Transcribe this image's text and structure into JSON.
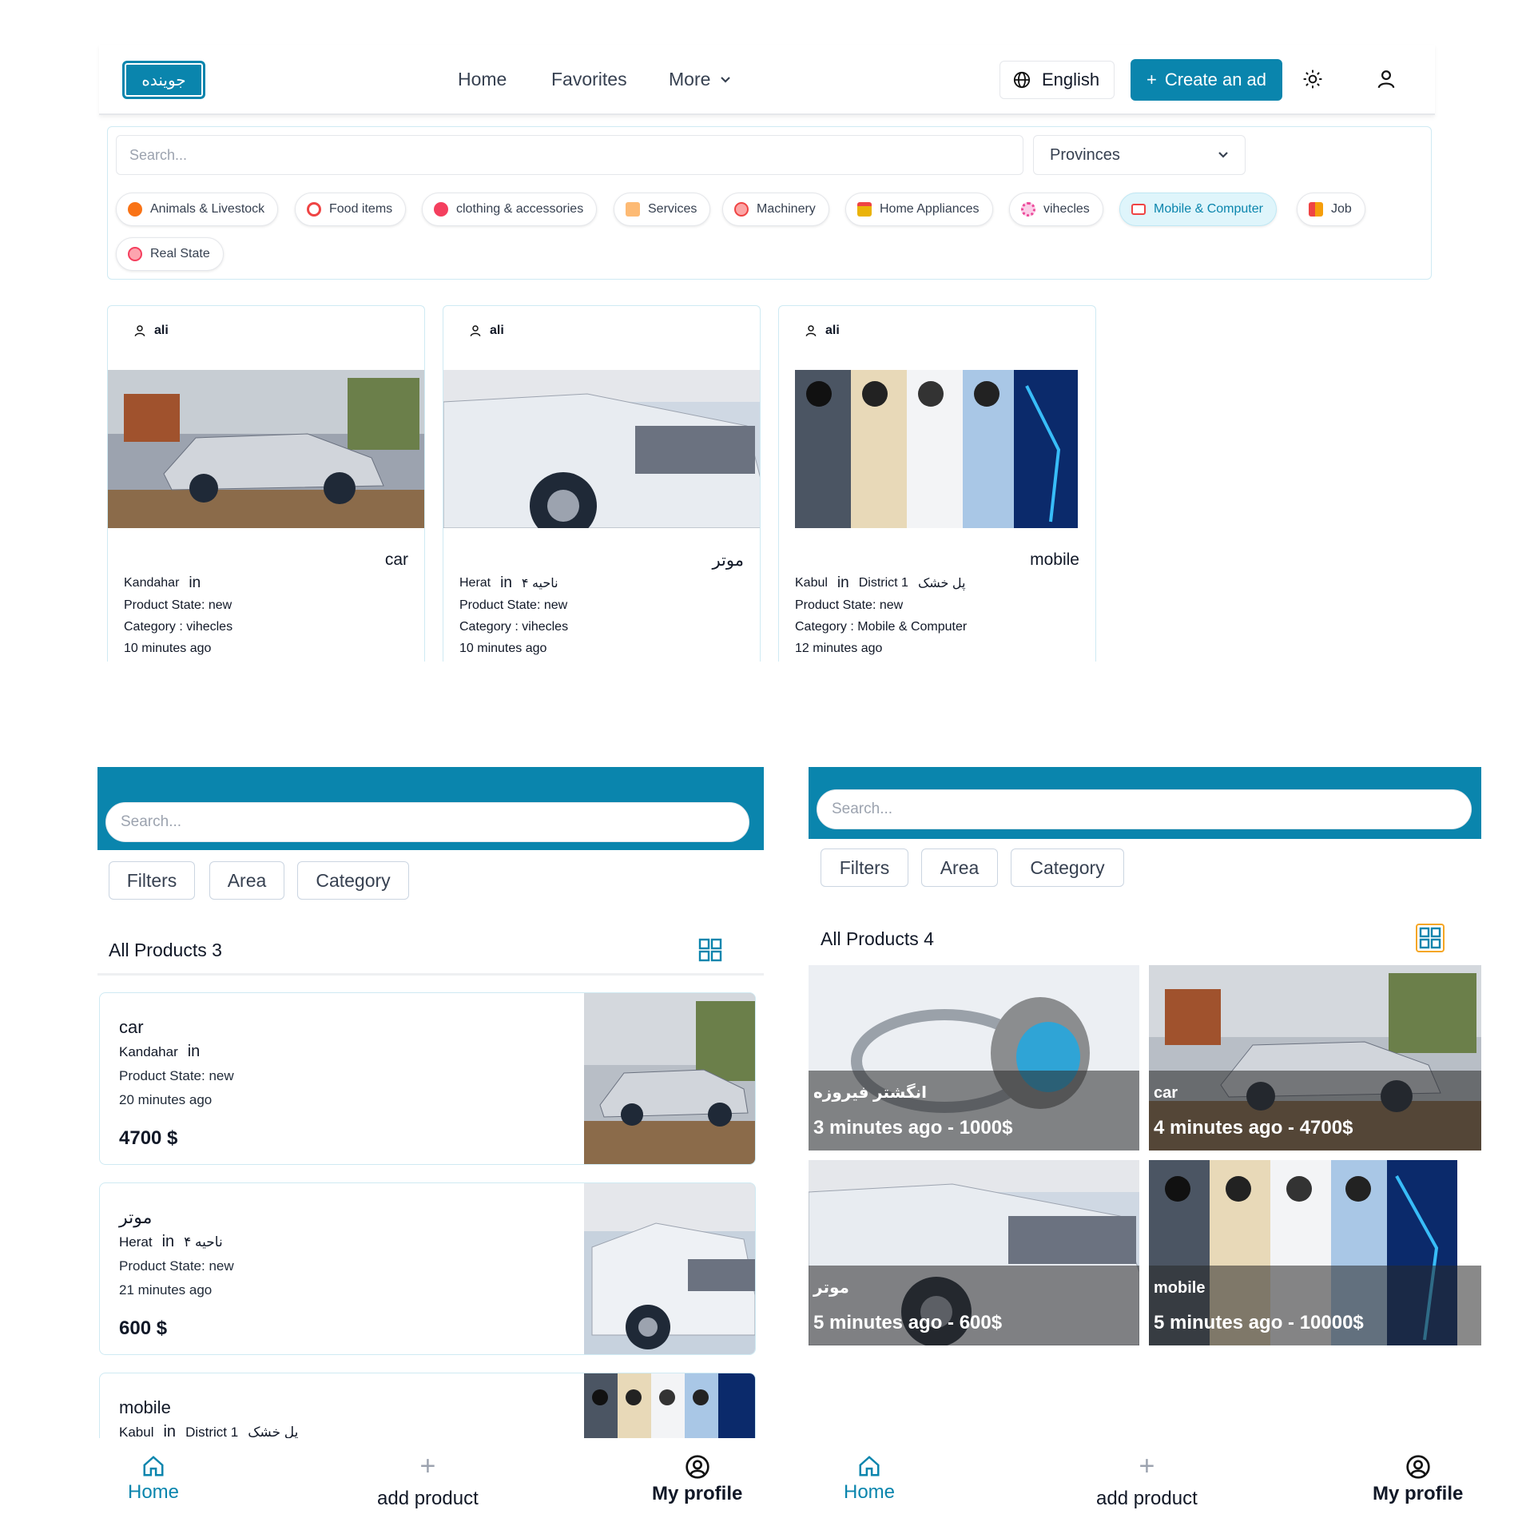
{
  "desktop": {
    "logo": "جوینده",
    "nav": {
      "home": "Home",
      "favorites": "Favorites",
      "more": "More"
    },
    "language": "English",
    "create_ad": "Create an ad",
    "search_placeholder": "Search...",
    "provinces": "Provinces",
    "categories": [
      {
        "label": "Animals & Livestock",
        "color": "#f97316"
      },
      {
        "label": "Food items",
        "color": "#ef4444"
      },
      {
        "label": "clothing & accessories",
        "color": "#f43f5e"
      },
      {
        "label": "Services",
        "color": "#fb923c"
      },
      {
        "label": "Machinery",
        "color": "#ef4444"
      },
      {
        "label": "Home Appliances",
        "color": "#eab308"
      },
      {
        "label": "vihecles",
        "color": "#ec4899"
      },
      {
        "label": "Mobile & Computer",
        "color": "#ef4444",
        "active": true
      },
      {
        "label": "Job",
        "color": "#f59e0b"
      },
      {
        "label": "Real State",
        "color": "#f43f5e"
      }
    ],
    "cards": [
      {
        "owner": "ali",
        "title": "car",
        "city": "Kandahar",
        "in": "in",
        "district": "",
        "area": "",
        "state": "Product State: new",
        "category": "Category : vihecles",
        "time": "10 minutes ago"
      },
      {
        "owner": "ali",
        "title": "موتر",
        "city": "Herat",
        "in": "in",
        "district": "ناحیه ۴",
        "area": "",
        "state": "Product State: new",
        "category": "Category : vihecles",
        "time": "10 minutes ago"
      },
      {
        "owner": "ali",
        "title": "mobile",
        "city": "Kabul",
        "in": "in",
        "district": "District 1",
        "area": "پل خشک",
        "state": "Product State: new",
        "category": "Category : Mobile & Computer",
        "time": "12 minutes ago"
      }
    ]
  },
  "mobile_list": {
    "search_placeholder": "Search...",
    "filters": [
      "Filters",
      "Area",
      "Category"
    ],
    "count_label": "All Products 3",
    "items": [
      {
        "title": "car",
        "city": "Kandahar",
        "in": "in",
        "district": "",
        "area": "",
        "state": "Product State: new",
        "time": "20 minutes ago",
        "price": "4700 $"
      },
      {
        "title": "موتر",
        "city": "Herat",
        "in": "in",
        "district": "ناحیه ۴",
        "area": "",
        "state": "Product State: new",
        "time": "21 minutes ago",
        "price": "600 $"
      },
      {
        "title": "mobile",
        "city": "Kabul",
        "in": "in",
        "district": "District 1",
        "area": "پل خشک",
        "state": "",
        "time": "",
        "price": ""
      }
    ],
    "bottom_nav": [
      "Home",
      "add product",
      "My profile"
    ]
  },
  "mobile_grid": {
    "search_placeholder": "Search...",
    "filters": [
      "Filters",
      "Area",
      "Category"
    ],
    "count_label": "All Products 4",
    "tiles": [
      {
        "title": "انگشتر فیروزه",
        "meta": "3 minutes ago - 1000$"
      },
      {
        "title": "car",
        "meta": "4 minutes ago - 4700$"
      },
      {
        "title": "موتر",
        "meta": "5 minutes ago - 600$"
      },
      {
        "title": "mobile",
        "meta": "5 minutes ago - 10000$"
      }
    ],
    "bottom_nav": [
      "Home",
      "add product",
      "My profile"
    ]
  },
  "colors": {
    "accent": "#0a85ad",
    "active_chip_bg": "#dff5fb",
    "grid_icon_highlight": "#f5a623"
  }
}
